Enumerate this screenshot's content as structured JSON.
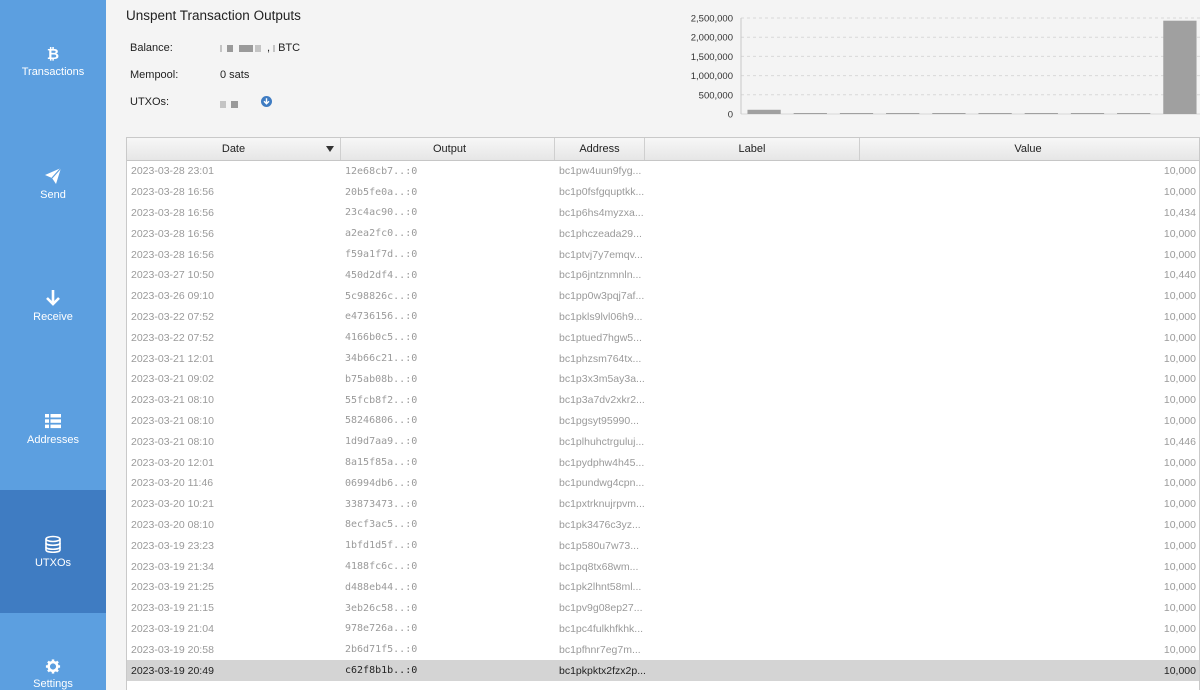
{
  "sidebar": {
    "items": [
      {
        "label": "Transactions",
        "icon": "bitcoin-icon"
      },
      {
        "label": "Send",
        "icon": "paper-plane-icon"
      },
      {
        "label": "Receive",
        "icon": "arrow-down-icon"
      },
      {
        "label": "Addresses",
        "icon": "list-icon"
      },
      {
        "label": "UTXOs",
        "icon": "coins-icon"
      },
      {
        "label": "Settings",
        "icon": "gear-icon"
      }
    ],
    "active": "UTXOs"
  },
  "header": {
    "title": "Unspent Transaction Outputs",
    "balance_label": "Balance:",
    "balance_suffix": "BTC",
    "mempool_label": "Mempool:",
    "mempool_value": "0 sats",
    "utxos_label": "UTXOs:"
  },
  "chart_data": {
    "type": "bar",
    "ylim": [
      0,
      2500000
    ],
    "yticks": [
      "0",
      "500,000",
      "1,000,000",
      "1,500,000",
      "2,000,000",
      "2,500,000"
    ],
    "values": [
      110000,
      20000,
      15000,
      15000,
      15000,
      15000,
      15000,
      15000,
      15000,
      2430000
    ],
    "grid": true,
    "legend": "none",
    "bar_color": "#a0a0a0"
  },
  "table": {
    "columns": [
      "Date",
      "Output",
      "Address",
      "Label",
      "Value"
    ],
    "rows": [
      {
        "date": "2023-03-28 23:01",
        "output": "12e68cb7..:0",
        "address": "bc1pw4uun9fyg...",
        "label": "",
        "value": "10,000"
      },
      {
        "date": "2023-03-28 16:56",
        "output": "20b5fe0a..:0",
        "address": "bc1p0fsfgquptkk...",
        "label": "",
        "value": "10,000"
      },
      {
        "date": "2023-03-28 16:56",
        "output": "23c4ac90..:0",
        "address": "bc1p6hs4myzxa...",
        "label": "",
        "value": "10,434"
      },
      {
        "date": "2023-03-28 16:56",
        "output": "a2ea2fc0..:0",
        "address": "bc1phczeada29...",
        "label": "",
        "value": "10,000"
      },
      {
        "date": "2023-03-28 16:56",
        "output": "f59a1f7d..:0",
        "address": "bc1ptvj7y7emqv...",
        "label": "",
        "value": "10,000"
      },
      {
        "date": "2023-03-27 10:50",
        "output": "450d2df4..:0",
        "address": "bc1p6jntznmnln...",
        "label": "",
        "value": "10,440"
      },
      {
        "date": "2023-03-26 09:10",
        "output": "5c98826c..:0",
        "address": "bc1pp0w3pqj7af...",
        "label": "",
        "value": "10,000"
      },
      {
        "date": "2023-03-22 07:52",
        "output": "e4736156..:0",
        "address": "bc1pkls9lvl06h9...",
        "label": "",
        "value": "10,000"
      },
      {
        "date": "2023-03-22 07:52",
        "output": "4166b0c5..:0",
        "address": "bc1ptued7hgw5...",
        "label": "",
        "value": "10,000"
      },
      {
        "date": "2023-03-21 12:01",
        "output": "34b66c21..:0",
        "address": "bc1phzsm764tx...",
        "label": "",
        "value": "10,000"
      },
      {
        "date": "2023-03-21 09:02",
        "output": "b75ab08b..:0",
        "address": "bc1p3x3m5ay3a...",
        "label": "",
        "value": "10,000"
      },
      {
        "date": "2023-03-21 08:10",
        "output": "55fcb8f2..:0",
        "address": "bc1p3a7dv2xkr2...",
        "label": "",
        "value": "10,000"
      },
      {
        "date": "2023-03-21 08:10",
        "output": "58246806..:0",
        "address": "bc1pgsyt95990...",
        "label": "",
        "value": "10,000"
      },
      {
        "date": "2023-03-21 08:10",
        "output": "1d9d7aa9..:0",
        "address": "bc1plhuhctrguluj...",
        "label": "",
        "value": "10,446"
      },
      {
        "date": "2023-03-20 12:01",
        "output": "8a15f85a..:0",
        "address": "bc1pydphw4h45...",
        "label": "",
        "value": "10,000"
      },
      {
        "date": "2023-03-20 11:46",
        "output": "06994db6..:0",
        "address": "bc1pundwg4cpn...",
        "label": "",
        "value": "10,000"
      },
      {
        "date": "2023-03-20 10:21",
        "output": "33873473..:0",
        "address": "bc1pxtrknujrpvm...",
        "label": "",
        "value": "10,000"
      },
      {
        "date": "2023-03-20 08:10",
        "output": "8ecf3ac5..:0",
        "address": "bc1pk3476c3yz...",
        "label": "",
        "value": "10,000"
      },
      {
        "date": "2023-03-19 23:23",
        "output": "1bfd1d5f..:0",
        "address": "bc1p580u7w73...",
        "label": "",
        "value": "10,000"
      },
      {
        "date": "2023-03-19 21:34",
        "output": "4188fc6c..:0",
        "address": "bc1pq8tx68wm...",
        "label": "",
        "value": "10,000"
      },
      {
        "date": "2023-03-19 21:25",
        "output": "d488eb44..:0",
        "address": "bc1pk2lhnt58ml...",
        "label": "",
        "value": "10,000"
      },
      {
        "date": "2023-03-19 21:15",
        "output": "3eb26c58..:0",
        "address": "bc1pv9g08ep27...",
        "label": "",
        "value": "10,000"
      },
      {
        "date": "2023-03-19 21:04",
        "output": "978e726a..:0",
        "address": "bc1pc4fulkhfkhk...",
        "label": "",
        "value": "10,000"
      },
      {
        "date": "2023-03-19 20:58",
        "output": "2b6d71f5..:0",
        "address": "bc1pfhnr7eg7m...",
        "label": "",
        "value": "10,000"
      },
      {
        "date": "2023-03-19 20:49",
        "output": "c62f8b1b..:0",
        "address": "bc1pkpktx2fzx2p...",
        "label": "",
        "value": "10,000"
      }
    ],
    "selected_row": 24
  }
}
